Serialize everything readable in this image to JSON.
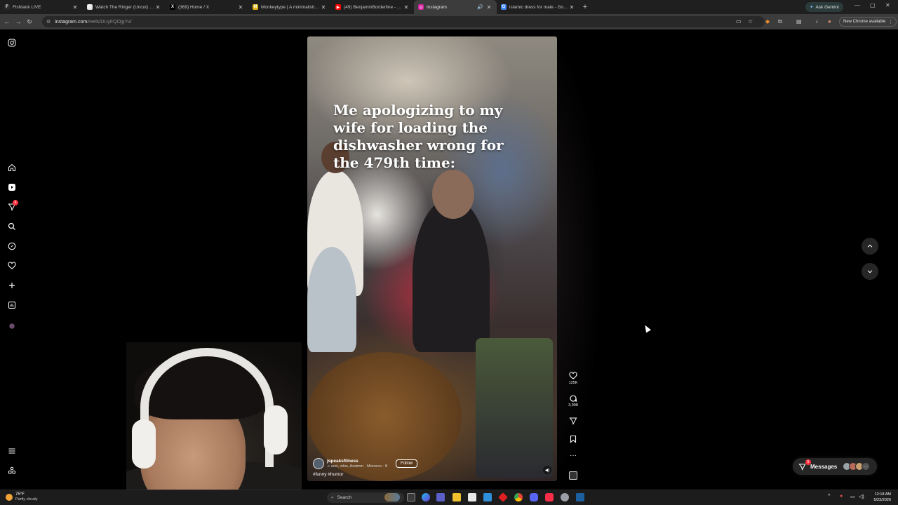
{
  "browser": {
    "tabs": [
      {
        "title": "Fishtank LIVE",
        "active": false,
        "favicon_color": "#2a2a2a",
        "favicon_glyph": "F"
      },
      {
        "title": "Watch The Ringer (Uncut) | Pri",
        "active": false,
        "favicon_color": "#e6e6e6",
        "favicon_glyph": "R"
      },
      {
        "title": "(369) Home / X",
        "active": false,
        "favicon_color": "#000000",
        "favicon_glyph": "X"
      },
      {
        "title": "Monkeytype | A minimalistic, c",
        "active": false,
        "favicon_color": "#e2b714",
        "favicon_glyph": "M"
      },
      {
        "title": "(49) BenjaminBorderline - YouT",
        "active": false,
        "favicon_color": "#ff0000",
        "favicon_glyph": "▶"
      },
      {
        "title": "Instagram",
        "active": true,
        "favicon_color": "#d6249f",
        "favicon_glyph": "◎"
      },
      {
        "title": "islamic dress for male - Google",
        "active": false,
        "favicon_color": "#4285f4",
        "favicon_glyph": "G"
      }
    ],
    "ask_gemini": "Ask Gemini",
    "url_host": "instagram.com",
    "url_path": "/reels/DUyFQOjgYu/",
    "new_chrome": "New Chrome available"
  },
  "reel": {
    "caption_lines": [
      "Me apologizing to my",
      "wife for loading the",
      "dishwasher wrong for",
      "the 479th time:"
    ],
    "author": "jspeaksfitness",
    "audio": "♫ ucci, vitos, Assimm · Morocco · 8",
    "follow_label": "Follow",
    "hashtags": "#funny #humor",
    "likes": "125K",
    "comments": "3,998"
  },
  "sidebar": {
    "notification_count": "6",
    "icons": [
      "instagram-icon",
      "home-icon",
      "reels-icon",
      "direct-icon",
      "search-icon",
      "explore-icon",
      "heart-icon",
      "create-icon",
      "dashboard-icon",
      "profile-icon",
      "menu-icon",
      "more-apps-icon"
    ]
  },
  "messages": {
    "label": "Messages",
    "count": "5"
  },
  "taskbar": {
    "temperature": "75°F",
    "condition": "Partly cloudy",
    "search_label": "Search",
    "time": "12:18 AM",
    "date": "5/23/2026"
  }
}
